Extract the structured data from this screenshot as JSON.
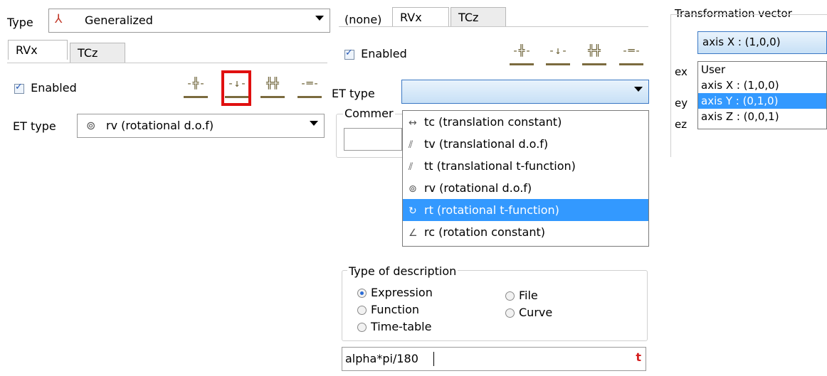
{
  "left": {
    "type_label": "Type",
    "type_value": "Generalized",
    "type_icon": "axes-icon",
    "tabs": [
      "RVx",
      "TCz"
    ],
    "enabled_label": "Enabled",
    "et_type_label": "ET type",
    "et_type_value": "rv (rotational d.o.f)"
  },
  "middle": {
    "tabs": [
      "(none)",
      "RVx",
      "TCz"
    ],
    "enabled_label": "Enabled",
    "et_type_label": "ET type",
    "comment_label": "Commer",
    "dropdown_items": [
      {
        "icon": "↔",
        "label": "tc (translation constant)"
      },
      {
        "icon": "⫽",
        "label": "tv (translational d.o.f)"
      },
      {
        "icon": "⫽",
        "label": "tt (translational t-function)"
      },
      {
        "icon": "⊚",
        "label": "rv (rotational d.o.f)"
      },
      {
        "icon": "↻",
        "label": "rt (rotational t-function)"
      },
      {
        "icon": "∠",
        "label": "rc (rotation constant)"
      }
    ],
    "selected_index": 4,
    "type_of_description_title": "Type of description",
    "options": [
      "Expression",
      "Function",
      "Time-table",
      "File",
      "Curve"
    ],
    "expression_value": "alpha*pi/180",
    "t_button": "t"
  },
  "right": {
    "title": "Transformation vector",
    "combo_value": "axis X : (1,0,0)",
    "row_labels": [
      "ex",
      "ey",
      "ez"
    ],
    "list": [
      "User",
      "axis X : (1,0,0)",
      "axis Y : (0,1,0)",
      "axis Z : (0,0,1)"
    ],
    "selected_index": 2
  },
  "colors": {
    "highlight": "#3399ff",
    "red_box": "#e01010",
    "toolbar_bar": "#7b6b3e"
  }
}
